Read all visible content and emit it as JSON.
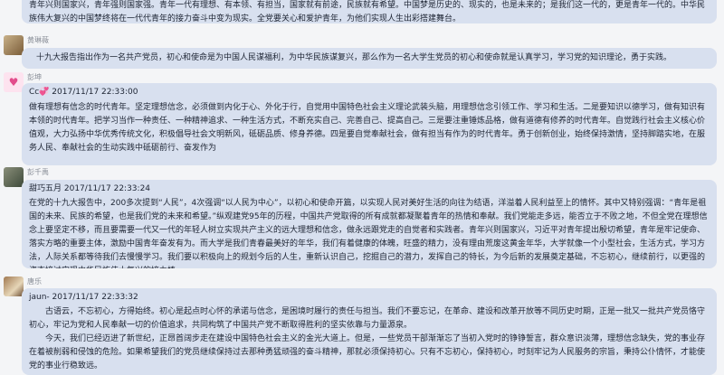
{
  "messages": [
    {
      "sender": "",
      "meta": "",
      "paragraphs": [
        "青年兴则国家兴，青年强则国家强。青年一代有理想、有本领、有担当，国家就有前途，民族就有希望。中国梦是历史的、现实的，也是未来的；是我们这一代的，更是青年一代的。中华民族伟大复兴的中国梦终将在一代代青年的接力奋斗中变为现实。全党要关心和爱护青年，为他们实现人生出彩搭建舞台。"
      ]
    },
    {
      "sender": "黄琳薇",
      "meta": "",
      "paragraphs": [
        "十九大报告指出作为一名共产党员，初心和使命是为中国人民谋福利，为中华民族谋复兴，那么作为一名大学生党员的初心和使命就是认真学习，学习党的知识理论，勇于实践。"
      ]
    },
    {
      "sender": "彭坤",
      "meta": "Cc💞 2017/11/17 22:33:00",
      "paragraphs": [
        "做有理想有信念的时代青年。坚定理想信念，必须做到内化于心、外化于行，自觉用中国特色社会主义理论武装头脑，用理想信念引领工作、学习和生活。二是要知识以德学习，做有知识有本领的时代青年。把学习当作一种责任、一种精神追求、一种生活方式，不断充实自己、完善自己、提高自己。三是要注重锤炼品格，做有道德有修养的时代青年。自觉践行社会主义核心价值观，大力弘扬中华优秀传统文化，积极倡导社会文明新风，砥砺品质、修身养德。四是要自觉奉献社会，做有担当有作为的时代青年。勇于创新创业，始终保持激情，坚持脚踏实地，在服务人民、奉献社会的生动实践中砥砺前行、奋发作为"
      ]
    },
    {
      "sender": "彭千禹",
      "meta": "甜巧五月 2017/11/17 22:33:24",
      "paragraphs": [
        "在党的十九大报告中，200多次提到“人民”，4次强调“以人民为中心”，以初心和使命开篇，以实现人民对美好生活的向往为结语，洋溢着人民利益至上的情怀。其中又特别强调：“青年是祖国的未来、民族的希望，也是我们党的未来和希望。”纵观建党95年的历程，中国共产党取得的所有成就都凝聚着青年的热情和奉献。我们党能走多远，能否立于不败之地，不但全党在理想信念上要坚定不移，而且要需要一代又一代的年轻人树立实现共产主义的远大理想和信念，做永远跟党走的自觉者和实践者。青年兴则国家兴，习近平对青年提出殷切希望，青年是牢记使命、落实方略的重要主体，激励中国青年奋发有为。而大学是我们青春最美好的年华，我们有着健康的体魄，旺盛的精力，没有理由荒废这黄金年华，大学就像一个小型社会，生活方式，学习方法，人际关系都等待我们去慢慢学习。我们要以积极向上的规划今后的人生，重新认识自己，挖掘自己的潜力，发挥自己的特长，为今后新的发展奠定基础，不忘初心，继续前行，以更强的姿态接过实现中华民族伟大复兴的接力棒。"
      ]
    },
    {
      "sender": "唐乐",
      "meta": "jaun- 2017/11/17 22:33:32",
      "paragraphs": [
        "古语云，不忘初心，方得始终。初心是起点时心怀的承诺与信念，是困境时履行的责任与担当。我们不要忘记，在革命、建设和改革开放等不同历史时期，正是一批又一批共产党员恪守初心，牢记为党和人民奉献一切的价值追求，共同构筑了中国共产党不断取得胜利的坚实依靠与力量源泉。",
        "今天，我们已经迈进了新世纪，正昂首阔步走在建设中国特色社会主义的金光大道上。但是，一些党员干部渐渐忘了当初入党时的铮铮誓言，群众意识淡薄，理想信念缺失，党的事业存在着被削弱和侵蚀的危险。如果希望我们的党员继续保持过去那种勇猛顽强的奋斗精神，那就必须保持初心。只有不忘初心，保持初心，时刻牢记为人民服务的宗旨，秉持公仆情怀，才能使党的事业行稳致远。"
      ]
    }
  ]
}
